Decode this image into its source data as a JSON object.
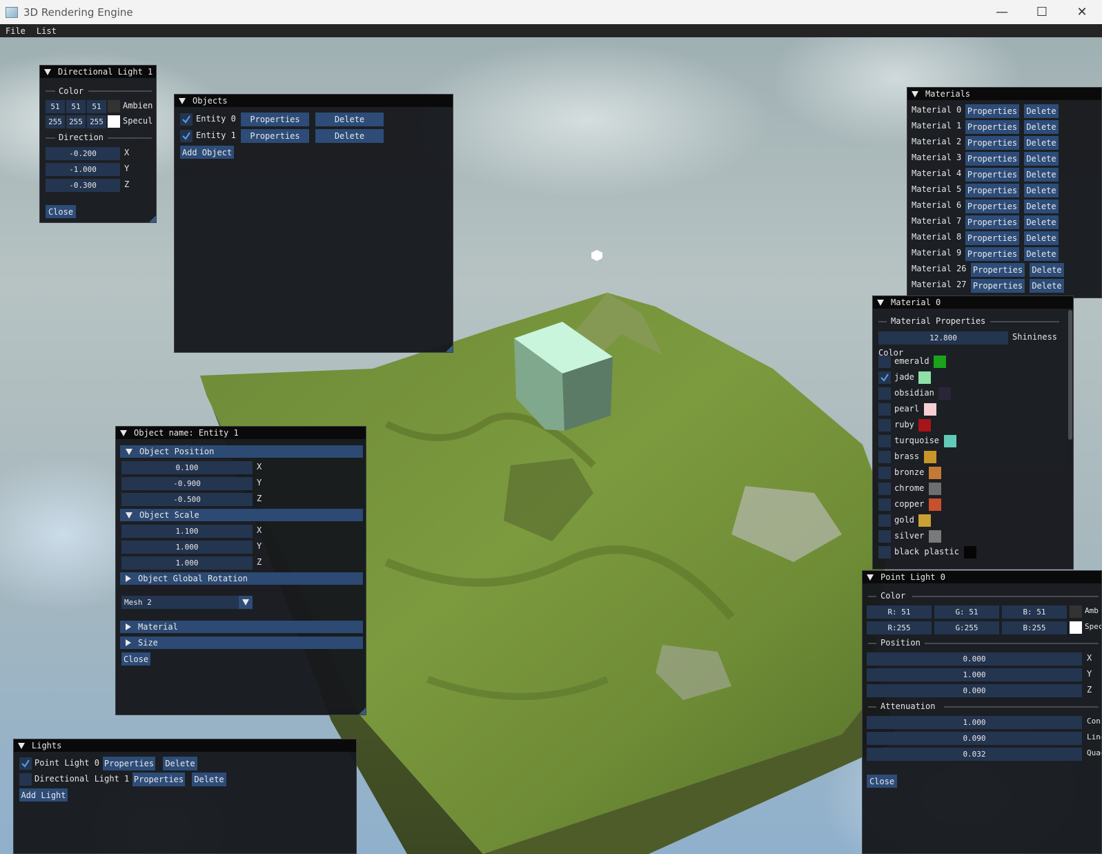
{
  "window": {
    "title": "3D Rendering Engine"
  },
  "menubar": {
    "items": [
      "File",
      "List"
    ]
  },
  "dir_light": {
    "title": "Directional Light 1",
    "color_label": "Color",
    "ambient": {
      "r": "51",
      "g": "51",
      "b": "51",
      "label": "Ambien",
      "swatch": "#333333"
    },
    "specular": {
      "r": "255",
      "g": "255",
      "b": "255",
      "label": "Specul",
      "swatch": "#ffffff"
    },
    "direction_label": "Direction",
    "x": "-0.200",
    "y": "-1.000",
    "z": "-0.300",
    "x_label": "X",
    "y_label": "Y",
    "z_label": "Z",
    "close": "Close"
  },
  "objects": {
    "title": "Objects",
    "entities": [
      {
        "name": "Entity 0",
        "checked": true
      },
      {
        "name": "Entity 1",
        "checked": true
      }
    ],
    "properties": "Properties",
    "delete": "Delete",
    "add": "Add Object"
  },
  "materials": {
    "title": "Materials",
    "items": [
      "Material 0",
      "Material 1",
      "Material 2",
      "Material 3",
      "Material 4",
      "Material 5",
      "Material 6",
      "Material 7",
      "Material 8",
      "Material 9",
      "Material 26",
      "Material 27"
    ],
    "properties": "Properties",
    "delete": "Delete"
  },
  "material0": {
    "title": "Material 0",
    "props_label": "Material Properties",
    "shininess_value": "12.800",
    "shininess_label": "Shininess",
    "color_label": "Color",
    "presets": [
      {
        "name": "emerald",
        "color": "#1aa31a",
        "checked": false
      },
      {
        "name": "jade",
        "color": "#8fe0a8",
        "checked": true
      },
      {
        "name": "obsidian",
        "color": "#2a2638",
        "checked": false
      },
      {
        "name": "pearl",
        "color": "#f5cfd2",
        "checked": false
      },
      {
        "name": "ruby",
        "color": "#a8141a",
        "checked": false
      },
      {
        "name": "turquoise",
        "color": "#62c9b8",
        "checked": false
      },
      {
        "name": "brass",
        "color": "#c8952a",
        "checked": false
      },
      {
        "name": "bronze",
        "color": "#c47a36",
        "checked": false
      },
      {
        "name": "chrome",
        "color": "#6e6e6e",
        "checked": false
      },
      {
        "name": "copper",
        "color": "#c8502a",
        "checked": false
      },
      {
        "name": "gold",
        "color": "#caa035",
        "checked": false
      },
      {
        "name": "silver",
        "color": "#7a7a7a",
        "checked": false
      },
      {
        "name": "black plastic",
        "color": "#050505",
        "checked": false
      }
    ]
  },
  "object_props": {
    "title": "Object name: Entity 1",
    "position_header": "Object Position",
    "pos": {
      "x": "0.100",
      "y": "-0.900",
      "z": "-0.500"
    },
    "scale_header": "Object Scale",
    "scale": {
      "x": "1.100",
      "y": "1.000",
      "z": "1.000"
    },
    "rotation_header": "Object Global Rotation",
    "axis": {
      "x": "X",
      "y": "Y",
      "z": "Z"
    },
    "mesh_value": "Mesh 2",
    "material_header": "Material",
    "size_header": "Size",
    "close": "Close"
  },
  "lights": {
    "title": "Lights",
    "items": [
      {
        "name": "Point Light 0",
        "checked": true
      },
      {
        "name": "Directional Light 1",
        "checked": false
      }
    ],
    "properties": "Properties",
    "delete": "Delete",
    "add": "Add Light"
  },
  "point_light": {
    "title": "Point Light 0",
    "color_label": "Color",
    "ambient": {
      "r": "R: 51",
      "g": "G: 51",
      "b": "B: 51",
      "label": "Amb",
      "swatch": "#333333"
    },
    "specular": {
      "r": "R:255",
      "g": "G:255",
      "b": "B:255",
      "label": "Spec",
      "swatch": "#ffffff"
    },
    "position_label": "Position",
    "x": "0.000",
    "y": "1.000",
    "z": "0.000",
    "x_label": "X",
    "y_label": "Y",
    "z_label": "Z",
    "attenuation_label": "Attenuation",
    "constant": "1.000",
    "linear": "0.090",
    "quadratic": "0.032",
    "constant_label": "Cons",
    "linear_label": "Line",
    "quadratic_label": "Quad",
    "close": "Close"
  },
  "colors": {
    "button": "#2d4c78",
    "field": "#243550",
    "window_bg": "#16181c",
    "title_bg": "#0a0a0a",
    "checkmark": "#4f9be8"
  }
}
